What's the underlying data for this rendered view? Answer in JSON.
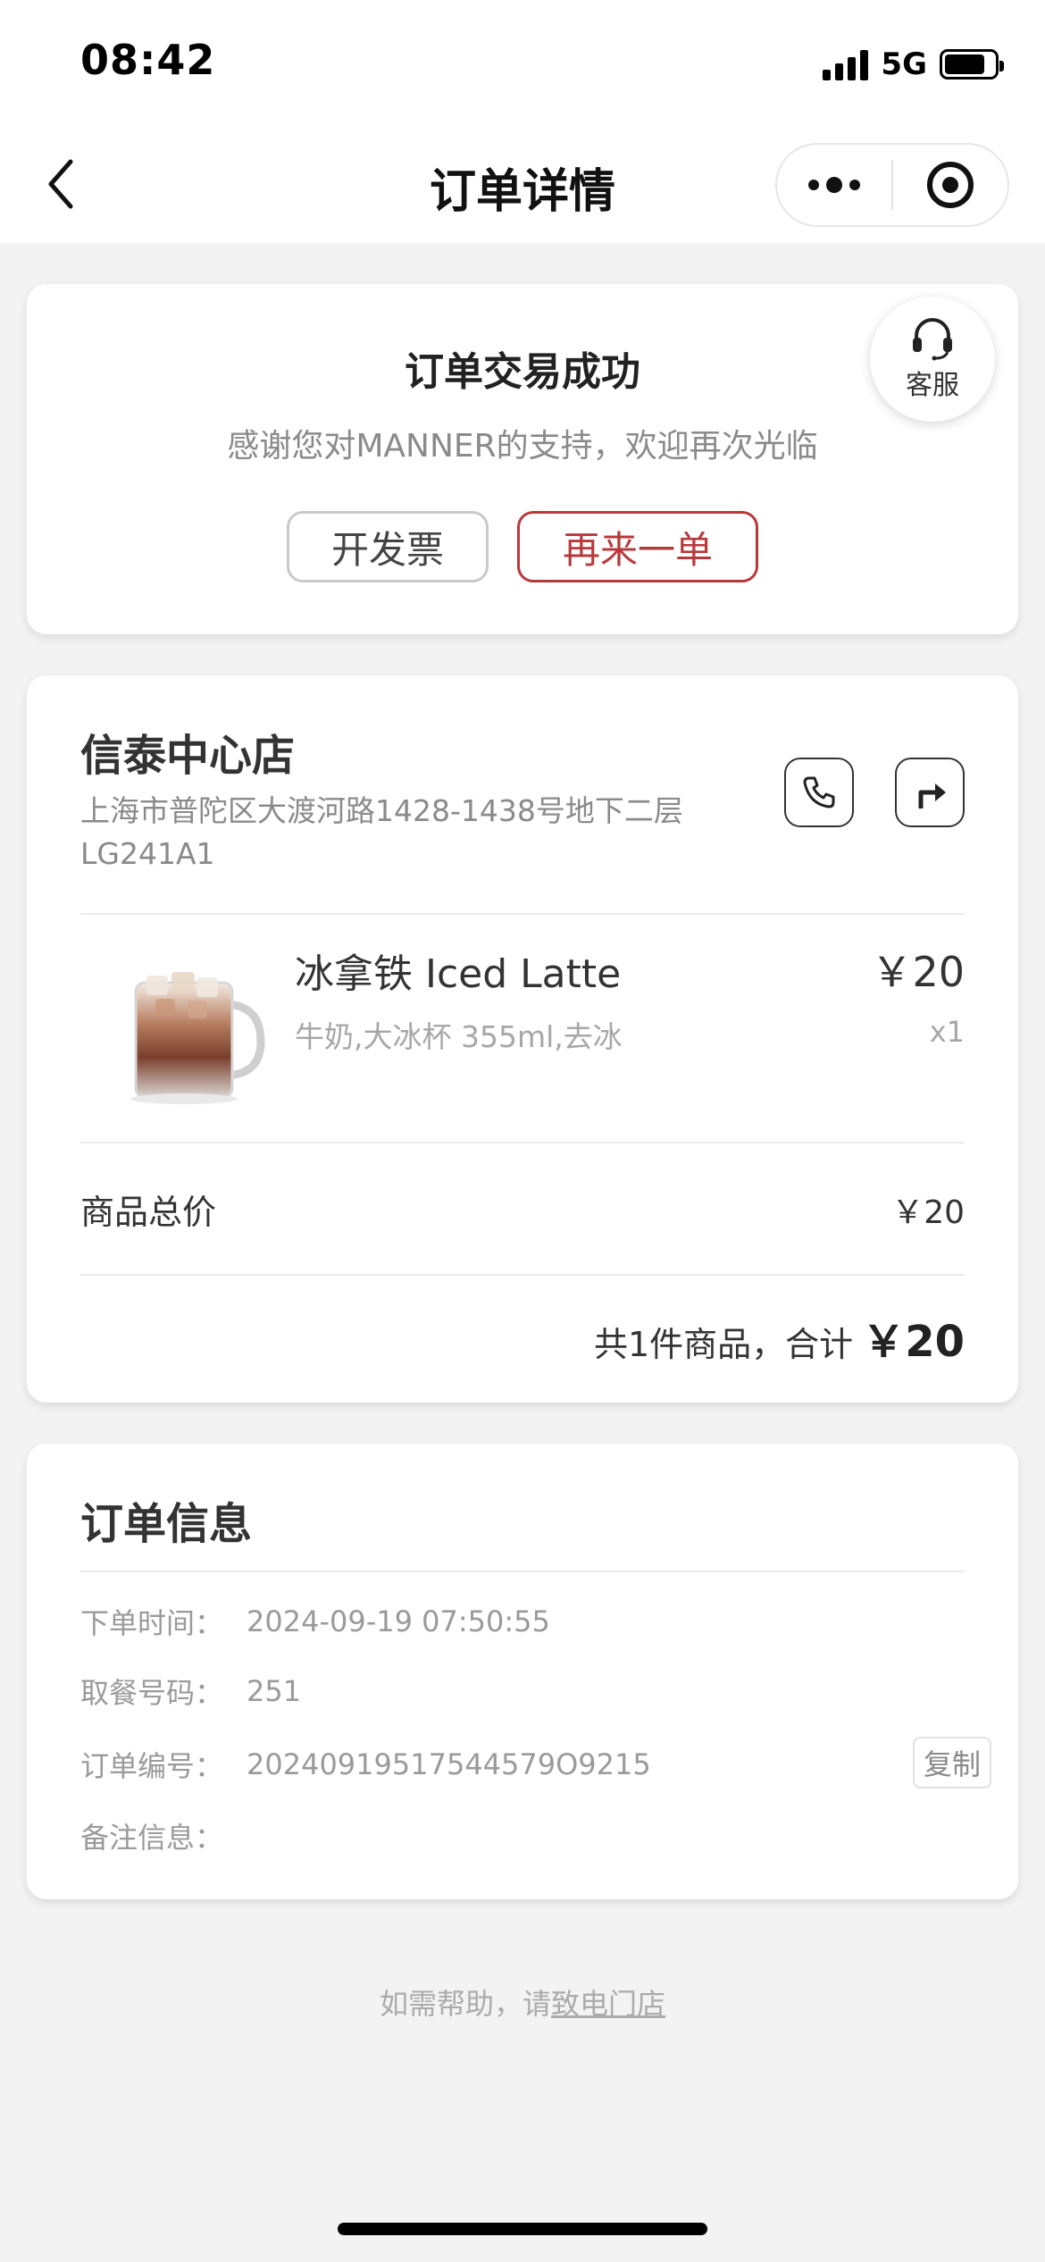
{
  "status_bar": {
    "time": "08:42",
    "network": "5G"
  },
  "nav": {
    "title": "订单详情"
  },
  "success": {
    "title": "订单交易成功",
    "subtitle": "感谢您对MANNER的支持，欢迎再次光临",
    "invoice_label": "开发票",
    "reorder_label": "再来一单",
    "service_label": "客服"
  },
  "store": {
    "name": "信泰中心店",
    "address": "上海市普陀区大渡河路1428-1438号地下二层LG241A1"
  },
  "product": {
    "name": "冰拿铁 Iced Latte",
    "options": "牛奶,大冰杯 355ml,去冰",
    "price": "￥20",
    "quantity": "x1"
  },
  "summary": {
    "subtotal_label": "商品总价",
    "subtotal_value": "￥20",
    "total_text": "共1件商品，合计",
    "total_amount": "￥20"
  },
  "order_info": {
    "title": "订单信息",
    "rows": [
      {
        "label": "下单时间：",
        "value": "2024-09-19 07:50:55"
      },
      {
        "label": "取餐号码：",
        "value": "251"
      },
      {
        "label": "订单编号：",
        "value": "20240919517544579O9215"
      },
      {
        "label": "备注信息：",
        "value": ""
      }
    ],
    "copy_label": "复制"
  },
  "help": {
    "prefix": "如需帮助，请",
    "link": "致电门店"
  },
  "colors": {
    "accent": "#b8393c",
    "background": "#f3f3f3",
    "card": "#ffffff",
    "muted": "#9a9a9a"
  }
}
